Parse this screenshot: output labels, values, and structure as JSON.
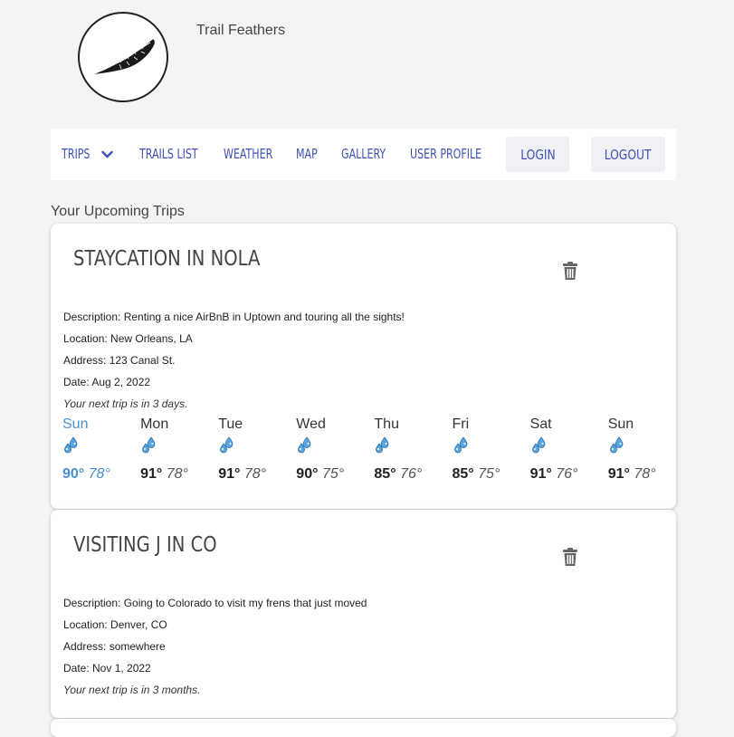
{
  "brand": {
    "name": "Trail Feathers",
    "logo_icon": "feather-icon"
  },
  "nav": {
    "trips": "TRIPS",
    "trails_list": "TRAILS LIST",
    "weather": "WEATHER",
    "map": "MAP",
    "gallery": "GALLERY",
    "user_profile": "USER PROFILE",
    "login": "LOGIN",
    "logout": "LOGOUT"
  },
  "section_title": "Your Upcoming Trips",
  "trips": [
    {
      "title": "STAYCATION IN NOLA",
      "description": "Description: Renting a nice AirBnB in Uptown and touring all the sights!",
      "location": "Location: New Orleans, LA",
      "address": "Address: 123 Canal St.",
      "date": "Date: Aug 2, 2022",
      "countdown": "Your next trip is in 3 days.",
      "forecast": [
        {
          "day": "Sun",
          "high": "90°",
          "low": "78°",
          "icon": "rain-drops-icon"
        },
        {
          "day": "Mon",
          "high": "91°",
          "low": "78°",
          "icon": "rain-drops-icon"
        },
        {
          "day": "Tue",
          "high": "91°",
          "low": "78°",
          "icon": "rain-drops-icon"
        },
        {
          "day": "Wed",
          "high": "90°",
          "low": "75°",
          "icon": "rain-drops-icon"
        },
        {
          "day": "Thu",
          "high": "85°",
          "low": "76°",
          "icon": "rain-drops-icon"
        },
        {
          "day": "Fri",
          "high": "85°",
          "low": "75°",
          "icon": "rain-drops-icon"
        },
        {
          "day": "Sat",
          "high": "91°",
          "low": "76°",
          "icon": "rain-drops-icon"
        },
        {
          "day": "Sun",
          "high": "91°",
          "low": "78°",
          "icon": "rain-drops-icon"
        }
      ]
    },
    {
      "title": "VISITING J IN CO",
      "description": "Description: Going to Colorado to visit my frens that just moved",
      "location": "Location: Denver, CO",
      "address": "Address: somewhere",
      "date": "Date: Nov 1, 2022",
      "countdown": "Your next trip is in 3 months."
    }
  ],
  "colors": {
    "nav_link": "#3f51b5",
    "today": "#4a8fd0",
    "background": "#f4f4f4"
  }
}
